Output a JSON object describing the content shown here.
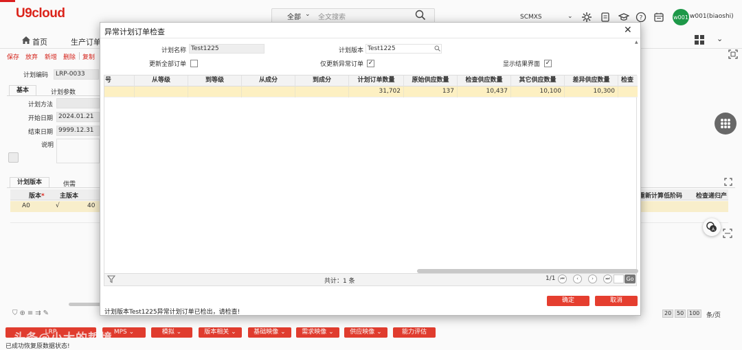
{
  "app": {
    "logo_text": "U9cloud"
  },
  "header": {
    "search": {
      "scope": "全部",
      "placeholder": "全文搜索"
    },
    "tenant": "SCMXS",
    "avatar_text": "w001",
    "username": "w001(biaoshi)",
    "icons": [
      "settings-gear-icon",
      "document-icon",
      "graduation-cap-icon",
      "help-icon",
      "calendar-icon"
    ]
  },
  "nav": {
    "home": "首页",
    "tab": "生产订单"
  },
  "toolbar": [
    "保存",
    "放弃",
    "新增",
    "删除",
    "复制"
  ],
  "form": {
    "plan_code_label": "计划编码",
    "plan_code": "LRP-0033",
    "tabs": [
      "基本",
      "计划参数"
    ],
    "fields": [
      {
        "label": "计划方法",
        "value": ""
      },
      {
        "label": "开始日期",
        "value": "2024.01.21"
      },
      {
        "label": "结束日期",
        "value": "9999.12.31"
      },
      {
        "label": "说明",
        "value": ""
      }
    ]
  },
  "lower": {
    "tabs": [
      "计划版本",
      "供需"
    ],
    "headers": [
      "版本",
      "主版本"
    ],
    "required_mark": "*",
    "right_headers": [
      "重新计算低阶码",
      "检查递归产"
    ],
    "row": {
      "version": "A0",
      "main": "√",
      "extra": "40"
    },
    "page_sizes": [
      "20",
      "50",
      "100"
    ],
    "per_page": "条/页"
  },
  "bottom_buttons": [
    "MPS",
    "模拟",
    "版本相关",
    "基础映像",
    "需求映像",
    "供应映像",
    "能力评估"
  ],
  "bottom_left_partial": "LRP",
  "watermark": "头条@小大的哲境",
  "status_text": "已成功恢复原数据状态!",
  "modal": {
    "title": "异常计划订单检查",
    "close": "✕",
    "plan_name_label": "计划名称",
    "plan_name": "Test1225",
    "plan_version_label": "计划版本",
    "plan_version": "Test1225",
    "update_all_label": "更新全部订单",
    "update_all": false,
    "only_abnormal_label": "仅更新异常订单",
    "only_abnormal": true,
    "show_result_label": "显示结果界面",
    "show_result": true,
    "columns": [
      "号",
      "从等级",
      "到等级",
      "从成分",
      "到成分",
      "计划订单数量",
      "原始供应数量",
      "检查供应数量",
      "其它供应数量",
      "差异供应数量",
      "检查"
    ],
    "rows": [
      {
        "c0": "",
        "c1": "",
        "c2": "",
        "c3": "",
        "c4": "",
        "plan_qty": "31,702",
        "orig_supply": "137",
        "check_supply": "10,437",
        "other_supply": "10,100",
        "diff_supply": "10,300",
        "c10": ""
      }
    ],
    "total": "共计：1 条",
    "page": "1/1",
    "go": "Go",
    "confirm": "确定",
    "cancel": "取消",
    "message": "计划版本Test1225异常计划订单已检出，请检查!"
  },
  "colors": {
    "brand": "#e0241b",
    "button": "#e53e2f",
    "highlight_row": "#fdf0c2",
    "avatar": "#1e9c4a"
  }
}
